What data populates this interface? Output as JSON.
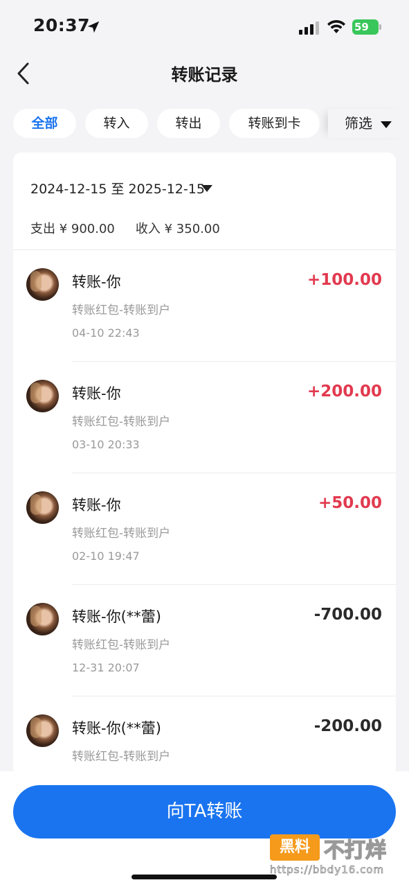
{
  "status_bar": {
    "time": "20:37",
    "battery": "59"
  },
  "nav": {
    "title": "转账记录"
  },
  "filters": {
    "tabs": [
      {
        "label": "全部",
        "active": true
      },
      {
        "label": "转入",
        "active": false
      },
      {
        "label": "转出",
        "active": false
      },
      {
        "label": "转账到卡",
        "active": false
      }
    ],
    "filter_label": "筛选"
  },
  "summary": {
    "date_range": "2024-12-15 至 2025-12-15",
    "expense": "支出 ¥ 900.00",
    "income": "收入 ¥ 350.00"
  },
  "transactions": [
    {
      "title": "转账-你",
      "subtitle": "转账红包-转账到户",
      "time": "04-10 22:43",
      "amount": "+100.00",
      "direction": "in"
    },
    {
      "title": "转账-你",
      "subtitle": "转账红包-转账到户",
      "time": "03-10 20:33",
      "amount": "+200.00",
      "direction": "in"
    },
    {
      "title": "转账-你",
      "subtitle": "转账红包-转账到户",
      "time": "02-10 19:47",
      "amount": "+50.00",
      "direction": "in"
    },
    {
      "title": "转账-你(**蕾)",
      "subtitle": "转账红包-转账到户",
      "time": "12-31 20:07",
      "amount": "-700.00",
      "direction": "out"
    },
    {
      "title": "转账-你(**蕾)",
      "subtitle": "转账红包-转账到户",
      "time": "",
      "amount": "-200.00",
      "direction": "out"
    }
  ],
  "footer": {
    "button_label": "向TA转账"
  },
  "watermark": {
    "badge": "黑料",
    "text": "不打烊",
    "url": "https://bbdy16.com"
  },
  "colors": {
    "accent": "#1a74f0",
    "income": "#e23a4f",
    "expense": "#2a2a2a"
  }
}
